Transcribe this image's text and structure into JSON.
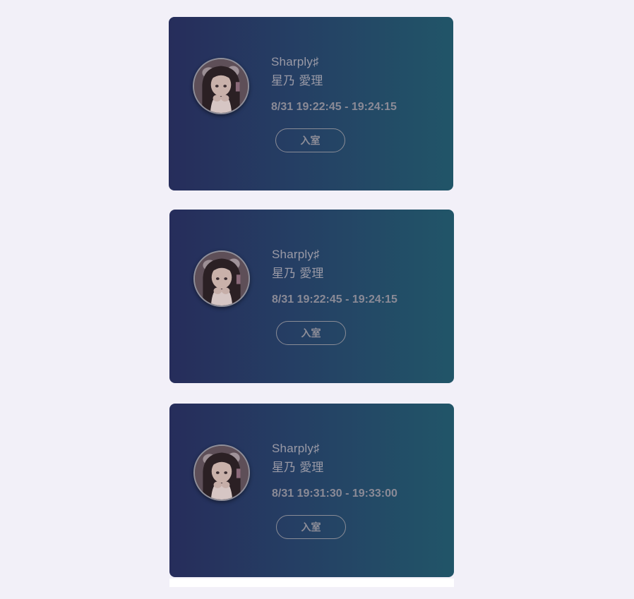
{
  "colors": {
    "page_background": "#f2f0f8",
    "card_gradient_start": "#262d5b",
    "card_gradient_end": "#215568",
    "text_muted": "#9a9aa6"
  },
  "slots": [
    {
      "group": "Sharply♯",
      "member": "星乃 愛理",
      "time": "8/31 19:22:45 - 19:24:15",
      "button_label": "入室",
      "avatar": "member-photo-avatar"
    },
    {
      "group": "Sharply♯",
      "member": "星乃 愛理",
      "time": "8/31 19:22:45 - 19:24:15",
      "button_label": "入室",
      "avatar": "member-photo-avatar"
    },
    {
      "group": "Sharply♯",
      "member": "星乃 愛理",
      "time": "8/31 19:31:30 - 19:33:00",
      "button_label": "入室",
      "avatar": "member-photo-avatar"
    }
  ]
}
